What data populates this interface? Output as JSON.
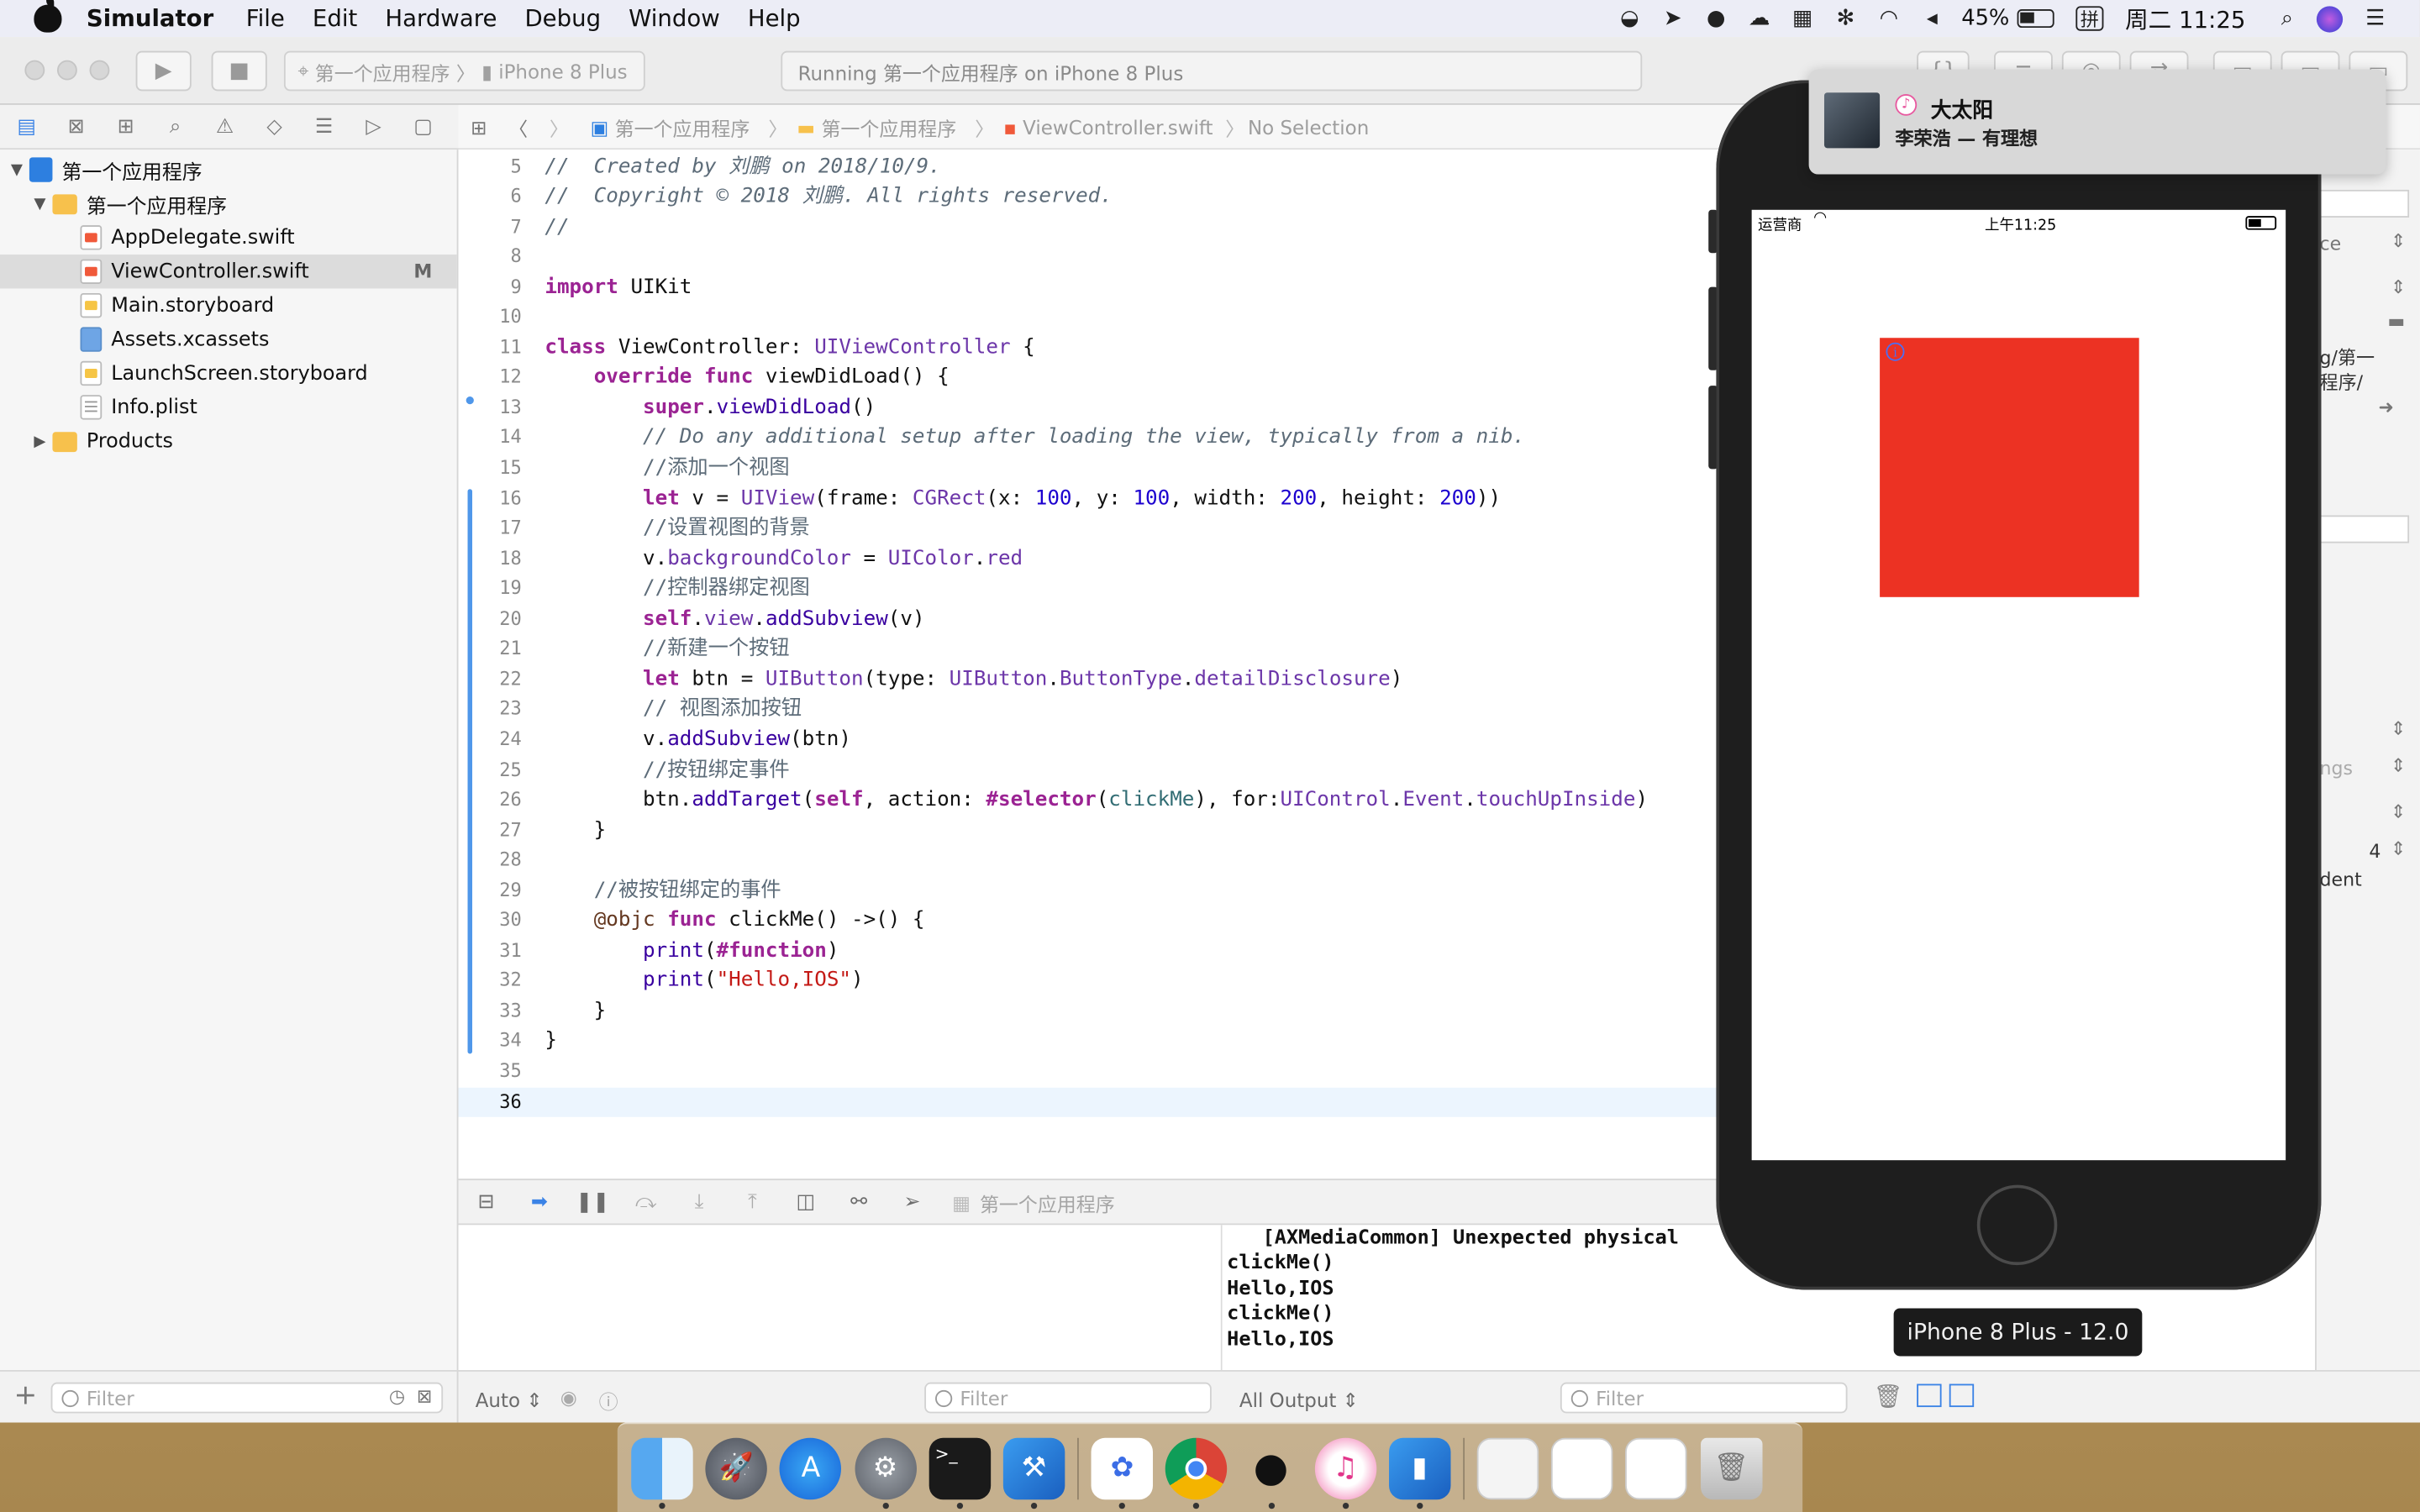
{
  "menubar": {
    "app_name": "Simulator",
    "items": [
      "File",
      "Edit",
      "Hardware",
      "Debug",
      "Window",
      "Help"
    ],
    "battery": "45%",
    "clock": "周二 11:25",
    "input_method": "拼"
  },
  "toolbar": {
    "scheme_project": "第一个应用程序",
    "scheme_device": "iPhone 8 Plus",
    "status": "Running 第一个应用程序 on iPhone 8 Plus"
  },
  "navigator": {
    "items": [
      {
        "label": "第一个应用程序",
        "kind": "project",
        "depth": 0,
        "expanded": true
      },
      {
        "label": "第一个应用程序",
        "kind": "folder",
        "depth": 1,
        "expanded": true
      },
      {
        "label": "AppDelegate.swift",
        "kind": "swift",
        "depth": 2
      },
      {
        "label": "ViewController.swift",
        "kind": "swift",
        "depth": 2,
        "selected": true,
        "badge": "M"
      },
      {
        "label": "Main.storyboard",
        "kind": "storyboard",
        "depth": 2
      },
      {
        "label": "Assets.xcassets",
        "kind": "assets",
        "depth": 2
      },
      {
        "label": "LaunchScreen.storyboard",
        "kind": "storyboard",
        "depth": 2
      },
      {
        "label": "Info.plist",
        "kind": "plist",
        "depth": 2
      },
      {
        "label": "Products",
        "kind": "folder",
        "depth": 0,
        "expanded": false
      }
    ],
    "filter_placeholder": "Filter"
  },
  "jumpbar": {
    "crumbs": [
      "第一个应用程序",
      "第一个应用程序",
      "ViewController.swift",
      "No Selection"
    ]
  },
  "editor": {
    "current_line": 36,
    "lines": [
      {
        "n": 5,
        "html": "<span class=\"cm\">//  Created by 刘鹏 on 2018/10/9.</span>"
      },
      {
        "n": 6,
        "html": "<span class=\"cm\">//  Copyright © 2018 刘鹏. All rights reserved.</span>"
      },
      {
        "n": 7,
        "html": "<span class=\"cm\">//</span>"
      },
      {
        "n": 8,
        "html": ""
      },
      {
        "n": 9,
        "html": "<span class=\"kw\">import</span> UIKit"
      },
      {
        "n": 10,
        "html": ""
      },
      {
        "n": 11,
        "html": "<span class=\"kw\">class</span> ViewController: <span class=\"tp\">UIViewController</span> {"
      },
      {
        "n": 12,
        "html": "    <span class=\"kw\">override</span> <span class=\"kw\">func</span> viewDidLoad() {"
      },
      {
        "n": 13,
        "html": "        <span class=\"kw\">super</span>.<span class=\"mt\">viewDidLoad</span>()"
      },
      {
        "n": 14,
        "html": "        <span class=\"cm\">// Do any additional setup after loading the view, typically from a nib.</span>"
      },
      {
        "n": 15,
        "html": "        <span class=\"cmz\">//添加一个视图</span>"
      },
      {
        "n": 16,
        "html": "        <span class=\"kw\">let</span> v = <span class=\"tp\">UIView</span>(frame: <span class=\"tp\">CGRect</span>(x: <span class=\"nm\">100</span>, y: <span class=\"nm\">100</span>, width: <span class=\"nm\">200</span>, height: <span class=\"nm\">200</span>))"
      },
      {
        "n": 17,
        "html": "        <span class=\"cmz\">//设置视图的背景</span>"
      },
      {
        "n": 18,
        "html": "        v.<span class=\"tp\">backgroundColor</span> = <span class=\"tp\">UIColor</span>.<span class=\"tp\">red</span>"
      },
      {
        "n": 19,
        "html": "        <span class=\"cmz\">//控制器绑定视图</span>"
      },
      {
        "n": 20,
        "html": "        <span class=\"kw\">self</span>.<span class=\"tp\">view</span>.<span class=\"mt\">addSubview</span>(v)"
      },
      {
        "n": 21,
        "html": "        <span class=\"cmz\">//新建一个按钮</span>"
      },
      {
        "n": 22,
        "html": "        <span class=\"kw\">let</span> btn = <span class=\"tp\">UIButton</span>(type: <span class=\"tp\">UIButton</span>.<span class=\"tp\">ButtonType</span>.<span class=\"tp\">detailDisclosure</span>)"
      },
      {
        "n": 23,
        "html": "        <span class=\"cmz\">// 视图添加按钮</span>"
      },
      {
        "n": 24,
        "html": "        v.<span class=\"mt\">addSubview</span>(btn)"
      },
      {
        "n": 25,
        "html": "        <span class=\"cmz\">//按钮绑定事件</span>"
      },
      {
        "n": 26,
        "html": "        btn.<span class=\"mt\">addTarget</span>(<span class=\"kw\">self</span>, action: <span class=\"kw\">#selector</span>(<span class=\"pm\">clickMe</span>), for:<span class=\"tp\">UIControl</span>.<span class=\"tp\">Event</span>.<span class=\"tp\">touchUpInside</span>)"
      },
      {
        "n": 27,
        "html": "    }"
      },
      {
        "n": 28,
        "html": ""
      },
      {
        "n": 29,
        "html": "    <span class=\"cmz\">//被按钮绑定的事件</span>"
      },
      {
        "n": 30,
        "html": "    <span class=\"at\">@objc</span> <span class=\"kw\">func</span> clickMe() ->() {"
      },
      {
        "n": 31,
        "html": "        <span class=\"mt\">print</span>(<span class=\"kw\">#function</span>)"
      },
      {
        "n": 32,
        "html": "        <span class=\"mt\">print</span>(<span class=\"st\">\"Hello,IOS\"</span>)"
      },
      {
        "n": 33,
        "html": "    }"
      },
      {
        "n": 34,
        "html": "}"
      },
      {
        "n": 35,
        "html": ""
      },
      {
        "n": 36,
        "html": ""
      }
    ]
  },
  "debugbar": {
    "target": "第一个应用程序"
  },
  "console": {
    "lines": [
      "   [AXMediaCommon] Unexpected physical",
      "clickMe()",
      "Hello,IOS",
      "clickMe()",
      "Hello,IOS"
    ]
  },
  "debug_footer": {
    "auto_label": "Auto",
    "vars_filter": "Filter",
    "output_label": "All Output",
    "console_filter": "Filter"
  },
  "inspector": {
    "fragments": [
      "ce",
      "g/第一",
      "程序/",
      "ngs",
      "4",
      "dent"
    ]
  },
  "simulator": {
    "notification": {
      "title": "大太阳",
      "subtitle": "李荣浩 — 有理想"
    },
    "ios_status": {
      "carrier": "运营商",
      "time": "上午11:25"
    },
    "red_view_color": "#ec3223",
    "device_tooltip": "iPhone 8 Plus - 12.0"
  }
}
